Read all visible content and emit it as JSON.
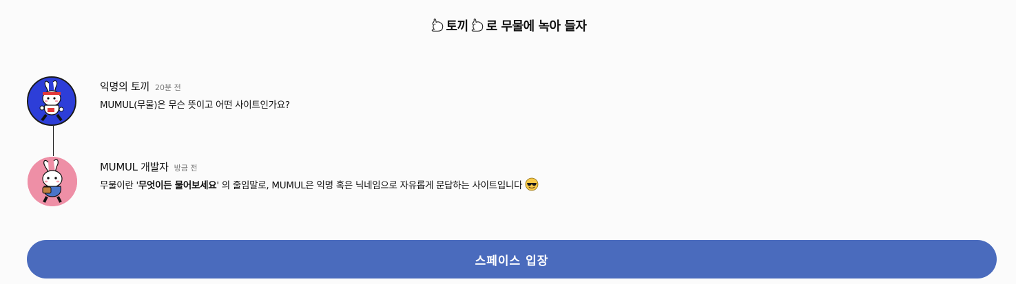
{
  "header": {
    "title_part1": "토끼",
    "title_part2": "로 무물에 녹아 들자",
    "icon": "rabbit-icon"
  },
  "thread": [
    {
      "author": "익명의 토끼",
      "time": "20분 전",
      "text": "MUMUL(무물)은 무슨 뜻이고 어떤 사이트인가요?",
      "avatar": "rabbit-runner-avatar"
    },
    {
      "author": "MUMUL 개발자",
      "time": "방금 전",
      "text_before": "무물이란 '",
      "text_bold": "무엇이든 물어보세요",
      "text_after": "' 의 줄임말로, MUMUL은 익명 혹은 닉네임으로 자유롭게 문답하는 사이트입니다",
      "emoji": "sunglasses-emoji",
      "avatar": "rabbit-developer-avatar"
    }
  ],
  "enter_button": {
    "label": "스페이스 입장",
    "color": "#4a6bbd"
  }
}
